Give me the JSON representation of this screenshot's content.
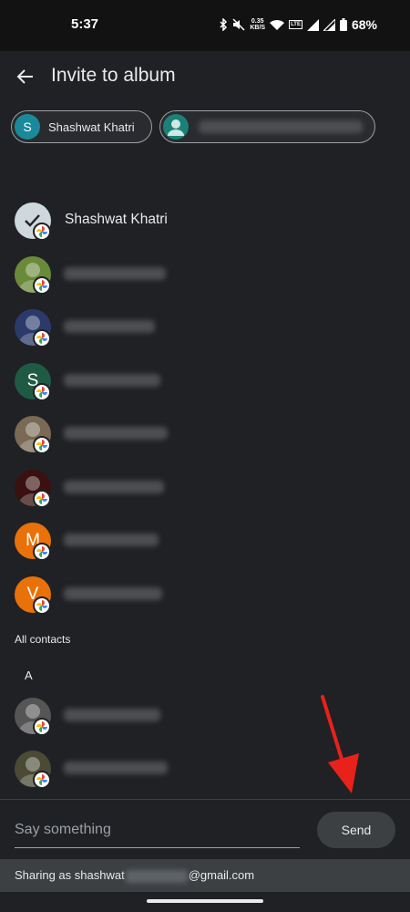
{
  "status_bar": {
    "time": "5:37",
    "net_speed": "0.35",
    "net_unit": "KB/S",
    "lte_label": "LTE",
    "battery": "68%"
  },
  "app_bar": {
    "title": "Invite to album",
    "back_icon": "arrow-left-icon"
  },
  "chips": [
    {
      "initial": "S",
      "label": "Shashwat Khatri"
    },
    {
      "initial": "",
      "label": ""
    }
  ],
  "suggested_contacts": [
    {
      "avatar_type": "selected",
      "name": "Shashwat Khatri",
      "color": "#cfd8dc"
    },
    {
      "avatar_type": "photo",
      "name": "",
      "color": "#6a8a3a"
    },
    {
      "avatar_type": "photo",
      "name": "",
      "color": "#2b3a6a"
    },
    {
      "avatar_type": "letter",
      "initial": "S",
      "name": "",
      "color": "#1f5a45"
    },
    {
      "avatar_type": "photo",
      "name": "",
      "color": "#7a6a55"
    },
    {
      "avatar_type": "photo",
      "name": "",
      "color": "#3a1010"
    },
    {
      "avatar_type": "letter",
      "initial": "M",
      "name": "",
      "color": "#e8710a"
    },
    {
      "avatar_type": "letter",
      "initial": "V",
      "name": "",
      "color": "#e8710a"
    }
  ],
  "all_contacts": {
    "section_label": "All contacts",
    "letter": "A",
    "items": [
      {
        "avatar_type": "photo",
        "name": "",
        "color": "#555555"
      },
      {
        "avatar_type": "photo",
        "name": "",
        "color": "#4a4a35"
      }
    ]
  },
  "compose": {
    "placeholder": "Say something",
    "send_label": "Send"
  },
  "sharing": {
    "prefix": "Sharing as shashwat",
    "suffix": "@gmail.com"
  }
}
